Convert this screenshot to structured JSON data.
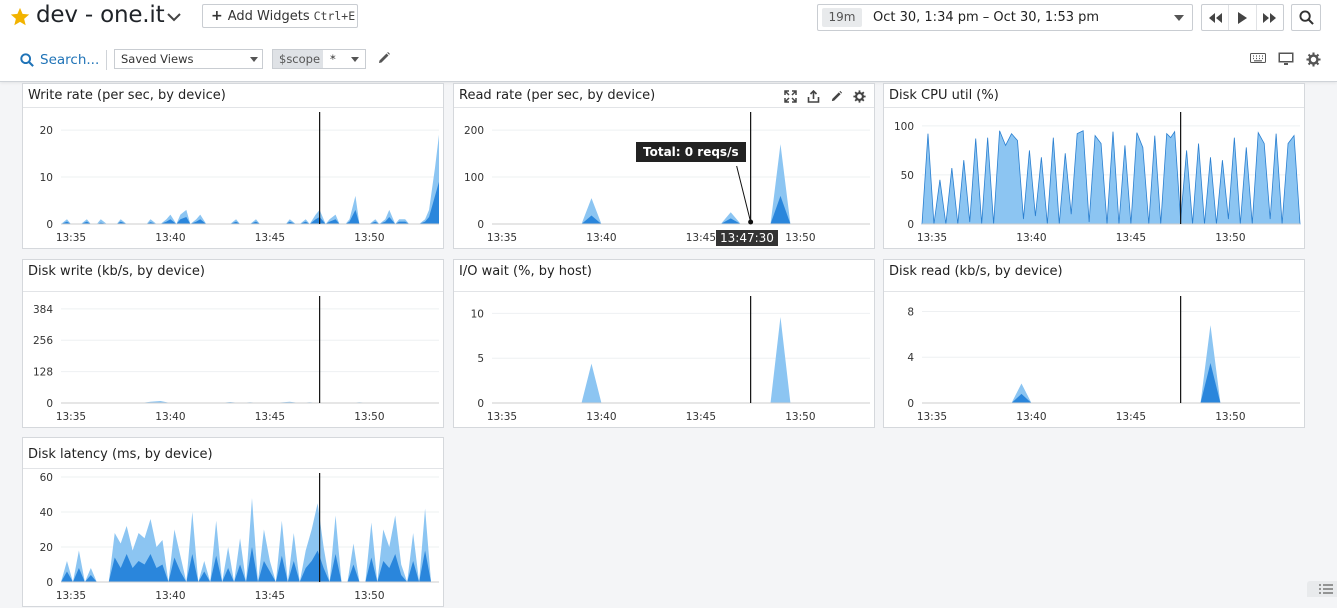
{
  "header": {
    "title": "dev - one.it",
    "add_widgets_label": "Add Widgets",
    "add_widgets_shortcut": "Ctrl+E",
    "time_duration": "19m",
    "time_range": "Oct 30, 1:34 pm – Oct 30, 1:53 pm",
    "search_label": "Search...",
    "saved_views_label": "Saved Views",
    "scope_key": "$scope",
    "scope_value": "*"
  },
  "colors": {
    "accent": "#1f73b7",
    "series_light": "#8cc5f2",
    "series_dark": "#2a86dc",
    "star": "#f2b300"
  },
  "widgets": [
    {
      "id": "w1",
      "title": "Write rate (per sec, by device)"
    },
    {
      "id": "w2",
      "title": "Read rate (per sec, by device)",
      "tooltip": "Total: 0 reqs/s",
      "cursor_time": "13:47:30"
    },
    {
      "id": "w3",
      "title": "Disk CPU util (%)"
    },
    {
      "id": "w4",
      "title": "Disk write (kb/s, by device)"
    },
    {
      "id": "w5",
      "title": "I/O wait (%, by host)"
    },
    {
      "id": "w6",
      "title": "Disk read (kb/s, by device)"
    },
    {
      "id": "w7",
      "title": "Disk latency (ms, by device)"
    }
  ],
  "chart_data": [
    {
      "id": "w1",
      "type": "area",
      "ylim": [
        0,
        23
      ],
      "yticks": [
        0,
        10,
        20
      ],
      "x": [
        0,
        0.3,
        0.5,
        0.8,
        1,
        1.3,
        1.5,
        1.8,
        2,
        2.3,
        2.5,
        2.8,
        3,
        3.3,
        3.5,
        3.8,
        4,
        4.3,
        4.5,
        4.8,
        5,
        5.3,
        5.5,
        5.8,
        6,
        6.3,
        6.5,
        6.8,
        7,
        7.3,
        7.5,
        7.8,
        8,
        8.3,
        8.5,
        8.8,
        9,
        9.3,
        9.5,
        9.8,
        10,
        10.3,
        10.5,
        10.8,
        11,
        11.3,
        11.5,
        11.8,
        12,
        12.3,
        12.5,
        12.8,
        13,
        13.3,
        13.5,
        13.8,
        14,
        14.3,
        14.5,
        14.8,
        15,
        15.3,
        15.5,
        15.8,
        16,
        16.3,
        16.5,
        16.8,
        17,
        17.3,
        17.5,
        17.8,
        18,
        18.3,
        18.5,
        18.8,
        19
      ],
      "series": [
        {
          "values": [
            0,
            1,
            0,
            0,
            0,
            1,
            0,
            0,
            1,
            0,
            0,
            0,
            1,
            0,
            0,
            0,
            0,
            0,
            1,
            0,
            0,
            1,
            2,
            0,
            2,
            3,
            0,
            1,
            2,
            0,
            0,
            0,
            0,
            0,
            0,
            1,
            0,
            0,
            0,
            1,
            0,
            0,
            0,
            0,
            0,
            0,
            1,
            0,
            0,
            1,
            0,
            2,
            3,
            0,
            1,
            2,
            0,
            0,
            1,
            6,
            0,
            0,
            0,
            1,
            0,
            1,
            3,
            0,
            1,
            1,
            0,
            0,
            0,
            1,
            3,
            12,
            19,
            12
          ]
        },
        {
          "values": [
            0,
            0.5,
            0,
            0,
            0,
            0.5,
            0,
            0,
            0.3,
            0,
            0,
            0,
            0.5,
            0,
            0,
            0,
            0,
            0,
            0.4,
            0,
            0,
            0.5,
            1,
            0,
            1,
            1.5,
            0,
            0.5,
            1,
            0,
            0,
            0,
            0,
            0,
            0,
            0.5,
            0,
            0,
            0,
            0.5,
            0,
            0,
            0,
            0,
            0,
            0,
            0.5,
            0,
            0,
            0.5,
            0,
            1,
            1.5,
            0,
            0.5,
            1,
            0,
            0,
            0.5,
            3,
            0,
            0,
            0,
            0.5,
            0,
            0.5,
            1.5,
            0,
            0.5,
            0.5,
            0,
            0,
            0,
            0.5,
            1.5,
            6,
            9,
            5
          ]
        }
      ]
    },
    {
      "id": "w2",
      "type": "area",
      "ylim": [
        0,
        230
      ],
      "yticks": [
        0,
        100,
        200
      ],
      "x": [
        0,
        0.5,
        1,
        1.5,
        2,
        2.5,
        3,
        3.5,
        4,
        4.5,
        5,
        5.5,
        6,
        6.5,
        7,
        7.5,
        8,
        8.5,
        9,
        9.5,
        10,
        10.5,
        11,
        11.5,
        12,
        12.5,
        13,
        13.5,
        14,
        14.5,
        15,
        15.5,
        16,
        16.5,
        17,
        17.5,
        18,
        18.5,
        19
      ],
      "series": [
        {
          "values": [
            0,
            0,
            0,
            0,
            0,
            0,
            0,
            0,
            0,
            0,
            55,
            0,
            0,
            0,
            0,
            0,
            0,
            0,
            0,
            0,
            0,
            0,
            0,
            0,
            25,
            0,
            0,
            0,
            0,
            170,
            0,
            0,
            0,
            0,
            0,
            0,
            0,
            0,
            0
          ]
        },
        {
          "values": [
            0,
            0,
            0,
            0,
            0,
            0,
            0,
            0,
            0,
            0,
            18,
            0,
            0,
            0,
            0,
            0,
            0,
            0,
            0,
            0,
            0,
            0,
            0,
            0,
            12,
            0,
            0,
            0,
            0,
            60,
            0,
            0,
            0,
            0,
            0,
            0,
            0,
            0,
            0
          ]
        }
      ]
    },
    {
      "id": "w3",
      "type": "area",
      "ylim": [
        0,
        110
      ],
      "yticks": [
        0,
        50,
        100
      ],
      "x": [
        0,
        0.3,
        0.6,
        0.9,
        1.2,
        1.5,
        1.8,
        2.1,
        2.4,
        2.7,
        3,
        3.3,
        3.6,
        3.9,
        4.2,
        4.5,
        4.8,
        5.1,
        5.4,
        5.7,
        6,
        6.3,
        6.6,
        6.9,
        7.2,
        7.5,
        7.8,
        8.1,
        8.4,
        8.7,
        9,
        9.3,
        9.6,
        9.9,
        10.2,
        10.5,
        10.8,
        11.1,
        11.4,
        11.7,
        12,
        12.3,
        12.5,
        12.7,
        13,
        13.3,
        13.6,
        13.9,
        14.2,
        14.5,
        14.8,
        15.1,
        15.4,
        15.7,
        16,
        16.3,
        16.6,
        16.9,
        17.2,
        17.5,
        17.8,
        18.1,
        18.4,
        18.7,
        19
      ],
      "series": [
        {
          "values": [
            0,
            92,
            0,
            45,
            0,
            57,
            0,
            65,
            2,
            87,
            0,
            88,
            0,
            95,
            80,
            92,
            85,
            5,
            75,
            8,
            68,
            0,
            88,
            0,
            72,
            10,
            92,
            95,
            2,
            90,
            82,
            0,
            94,
            0,
            80,
            0,
            93,
            78,
            0,
            90,
            0,
            92,
            88,
            94,
            4,
            75,
            0,
            82,
            0,
            68,
            0,
            65,
            5,
            88,
            0,
            78,
            0,
            93,
            82,
            5,
            92,
            0,
            82,
            90,
            0
          ]
        },
        {
          "values": [
            0,
            0,
            0,
            0,
            0,
            0,
            0,
            0,
            0,
            0,
            0,
            0,
            0,
            0,
            0,
            0,
            0,
            0,
            0,
            0,
            0,
            0,
            0,
            0,
            0,
            0,
            0,
            0,
            0,
            0,
            0,
            0,
            0,
            0,
            0,
            0,
            0,
            0,
            0,
            0,
            0,
            0,
            0,
            0,
            0,
            0,
            0,
            0,
            0,
            0,
            0,
            0,
            0,
            0,
            0,
            0,
            0,
            0,
            0,
            0,
            0,
            0,
            0,
            0,
            0
          ]
        }
      ]
    },
    {
      "id": "w4",
      "type": "area",
      "ylim": [
        0,
        420
      ],
      "yticks": [
        0,
        128,
        256,
        384
      ],
      "x": [
        0,
        0.5,
        1,
        1.5,
        2,
        2.5,
        3,
        3.5,
        4,
        4.5,
        5,
        5.5,
        6,
        6.5,
        7,
        7.5,
        8,
        8.5,
        9,
        9.5,
        10,
        10.5,
        11,
        11.5,
        12,
        12.5,
        13,
        13.5,
        14,
        14.5,
        15,
        15.5,
        16,
        16.5,
        17,
        17.5,
        18,
        18.5,
        19
      ],
      "series": [
        {
          "values": [
            0,
            0,
            0,
            0,
            2,
            0,
            0,
            0,
            0,
            5,
            8,
            0,
            0,
            0,
            0,
            0,
            0,
            4,
            0,
            3,
            0,
            0,
            2,
            5,
            0,
            3,
            0,
            0,
            0,
            0,
            3,
            0,
            0,
            0,
            0,
            0,
            0,
            0,
            0
          ]
        },
        {
          "values": [
            0,
            0,
            0,
            0,
            0,
            0,
            0,
            0,
            0,
            0,
            0,
            0,
            0,
            0,
            0,
            0,
            0,
            0,
            0,
            0,
            0,
            0,
            0,
            0,
            0,
            0,
            0,
            0,
            0,
            0,
            0,
            0,
            0,
            0,
            0,
            0,
            0,
            0,
            0
          ]
        }
      ]
    },
    {
      "id": "w5",
      "type": "area",
      "ylim": [
        0,
        11.5
      ],
      "yticks": [
        0,
        5,
        10
      ],
      "x": [
        0,
        0.5,
        1,
        1.5,
        2,
        2.5,
        3,
        3.5,
        4,
        4.5,
        5,
        5.5,
        6,
        6.5,
        7,
        7.5,
        8,
        8.5,
        9,
        9.5,
        10,
        10.5,
        11,
        11.5,
        12,
        12.5,
        13,
        13.5,
        14,
        14.5,
        15,
        15.5,
        16,
        16.5,
        17,
        17.5,
        18,
        18.5,
        19
      ],
      "series": [
        {
          "values": [
            0,
            0,
            0,
            0,
            0,
            0,
            0,
            0,
            0,
            0,
            4.4,
            0,
            0,
            0,
            0,
            0,
            0,
            0,
            0,
            0,
            0,
            0,
            0,
            0,
            0,
            0,
            0,
            0,
            0,
            9.6,
            0,
            0,
            0,
            0,
            0,
            0,
            0,
            0,
            0
          ]
        },
        {
          "values": [
            0,
            0,
            0,
            0,
            0,
            0,
            0,
            0,
            0,
            0,
            0,
            0,
            0,
            0,
            0,
            0,
            0,
            0,
            0,
            0,
            0,
            0,
            0,
            0,
            0,
            0,
            0,
            0,
            0,
            0,
            0,
            0,
            0,
            0,
            0,
            0,
            0,
            0,
            0
          ]
        }
      ]
    },
    {
      "id": "w6",
      "type": "area",
      "ylim": [
        0,
        9
      ],
      "yticks": [
        0,
        4,
        8
      ],
      "x": [
        0,
        0.5,
        1,
        1.5,
        2,
        2.5,
        3,
        3.5,
        4,
        4.5,
        5,
        5.5,
        6,
        6.5,
        7,
        7.5,
        8,
        8.5,
        9,
        9.5,
        10,
        10.5,
        11,
        11.5,
        12,
        12.5,
        13,
        13.5,
        14,
        14.5,
        15,
        15.5,
        16,
        16.5,
        17,
        17.5,
        18,
        18.5,
        19
      ],
      "series": [
        {
          "values": [
            0,
            0,
            0,
            0,
            0,
            0,
            0,
            0,
            0,
            0,
            1.7,
            0,
            0,
            0,
            0,
            0,
            0,
            0,
            0,
            0,
            0,
            0,
            0,
            0,
            0,
            0,
            0,
            0,
            0,
            6.8,
            0,
            0,
            0,
            0,
            0,
            0,
            0,
            0,
            0
          ]
        },
        {
          "values": [
            0,
            0,
            0,
            0,
            0,
            0,
            0,
            0,
            0,
            0,
            0.8,
            0,
            0,
            0,
            0,
            0,
            0,
            0,
            0,
            0,
            0,
            0,
            0,
            0,
            0,
            0,
            0,
            0,
            0,
            3.5,
            0,
            0,
            0,
            0,
            0,
            0,
            0,
            0,
            0
          ]
        }
      ]
    },
    {
      "id": "w7",
      "type": "area",
      "ylim": [
        0,
        60
      ],
      "yticks": [
        0,
        20,
        40,
        60
      ],
      "x": [
        0,
        0.3,
        0.6,
        0.9,
        1.2,
        1.5,
        1.8,
        2.1,
        2.4,
        2.7,
        3,
        3.3,
        3.6,
        3.9,
        4.2,
        4.5,
        4.8,
        5.1,
        5.4,
        5.7,
        6,
        6.3,
        6.6,
        6.9,
        7.2,
        7.5,
        7.8,
        8.1,
        8.4,
        8.7,
        9,
        9.3,
        9.6,
        9.9,
        10.2,
        10.5,
        10.8,
        11.1,
        11.4,
        11.7,
        12,
        12.3,
        12.6,
        12.9,
        13.2,
        13.5,
        13.8,
        14.1,
        14.4,
        14.7,
        15,
        15.3,
        15.6,
        15.9,
        16.2,
        16.5,
        16.8,
        17.1,
        17.4,
        17.7,
        18,
        18.3,
        18.6,
        18.9,
        19
      ],
      "series": [
        {
          "values": [
            0,
            12,
            0,
            18,
            0,
            8,
            0,
            0,
            0,
            28,
            22,
            32,
            18,
            28,
            25,
            36,
            20,
            24,
            0,
            30,
            15,
            0,
            40,
            0,
            12,
            0,
            35,
            0,
            20,
            0,
            25,
            0,
            48,
            0,
            30,
            12,
            0,
            35,
            0,
            28,
            0,
            18,
            30,
            45,
            20,
            0,
            38,
            0,
            0,
            22,
            0,
            0,
            34,
            0,
            30,
            20,
            38,
            10,
            0,
            28,
            0,
            42,
            0,
            0,
            0
          ]
        },
        {
          "values": [
            0,
            6,
            0,
            8,
            0,
            4,
            0,
            0,
            0,
            14,
            8,
            16,
            8,
            12,
            10,
            16,
            8,
            10,
            0,
            14,
            6,
            0,
            16,
            0,
            6,
            0,
            15,
            0,
            8,
            0,
            10,
            0,
            20,
            0,
            12,
            6,
            0,
            15,
            0,
            12,
            0,
            8,
            12,
            18,
            8,
            0,
            16,
            0,
            0,
            10,
            0,
            0,
            14,
            0,
            12,
            8,
            16,
            4,
            0,
            12,
            0,
            18,
            0,
            0,
            0
          ]
        }
      ]
    }
  ]
}
